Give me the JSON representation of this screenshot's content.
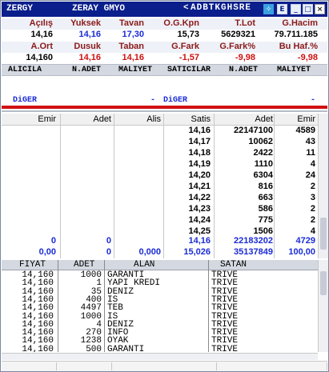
{
  "window": {
    "symbol": "ZERGY",
    "company": "ZERAY GMYO",
    "ticker": "ADBTKGHSRE",
    "left_arrow_icon": "left-arrow-icon",
    "icons": [
      "twitter-bird-icon",
      "e-icon",
      "minimize-icon",
      "restore-icon",
      "close-icon"
    ],
    "icon_glyphs": [
      "✧",
      "E",
      "_",
      "□",
      "×"
    ]
  },
  "stats": {
    "row1_labels": [
      "Açılış",
      "Yuksek",
      "Tavan",
      "O.G.Kpn",
      "T.Lot",
      "G.Hacim"
    ],
    "row1_values": [
      "14,16",
      "14,16",
      "17,30",
      "15,73",
      "5629321",
      "79.711.185"
    ],
    "row2_labels": [
      "A.Ort",
      "Dusuk",
      "Taban",
      "G.Fark",
      "G.Fark%",
      "Bu Haf.%"
    ],
    "row2_values": [
      "14,160",
      "14,16",
      "14,16",
      "-1,57",
      "-9,98",
      "-9,98"
    ]
  },
  "broker_header": [
    "ALICILA",
    "N.ADET",
    "MALIYET",
    "SATICILAR",
    "N.ADET",
    "MALIYET"
  ],
  "broker_other": {
    "left": "DiGER",
    "mid": "-",
    "right": "DiGER",
    "end": "-"
  },
  "depth": {
    "headers": [
      "Emir",
      "Adet",
      "Alis",
      "Satis",
      "Adet",
      "Emir"
    ],
    "rows": [
      [
        "14,16",
        "22147100",
        "4589"
      ],
      [
        "14,17",
        "10062",
        "43"
      ],
      [
        "14,18",
        "2422",
        "11"
      ],
      [
        "14,19",
        "1110",
        "4"
      ],
      [
        "14,20",
        "6304",
        "24"
      ],
      [
        "14,21",
        "816",
        "2"
      ],
      [
        "14,22",
        "663",
        "3"
      ],
      [
        "14,23",
        "586",
        "2"
      ],
      [
        "14,24",
        "775",
        "2"
      ],
      [
        "14,25",
        "1506",
        "4"
      ]
    ],
    "total1": [
      "0",
      "0",
      "",
      "14,16",
      "22183202",
      "4729"
    ],
    "total2": [
      "0,00",
      "0",
      "0,000",
      "15,026",
      "35137849",
      "100,00"
    ]
  },
  "trades": {
    "headers": [
      "FIYAT",
      "ADET",
      "ALAN",
      "SATAN"
    ],
    "rows": [
      [
        "14,160",
        "1000",
        "GARANTI",
        "TRIVE"
      ],
      [
        "14,160",
        "1",
        "YAPI KREDI",
        "TRIVE"
      ],
      [
        "14,160",
        "35",
        "DENIZ",
        "TRIVE"
      ],
      [
        "14,160",
        "400",
        "IS",
        "TRIVE"
      ],
      [
        "14,160",
        "4497",
        "TEB",
        "TRIVE"
      ],
      [
        "14,160",
        "1000",
        "IS",
        "TRIVE"
      ],
      [
        "14,160",
        "4",
        "DENIZ",
        "TRIVE"
      ],
      [
        "14,160",
        "270",
        "INFO",
        "TRIVE"
      ],
      [
        "14,160",
        "1238",
        "OYAK",
        "TRIVE"
      ],
      [
        "14,160",
        "500",
        "GARANTI",
        "TRIVE"
      ]
    ]
  },
  "colors": {
    "title_bg": "#0a1e8c",
    "label": "#8b1a1a",
    "blue": "#1a2bd6",
    "red": "#d01010"
  }
}
